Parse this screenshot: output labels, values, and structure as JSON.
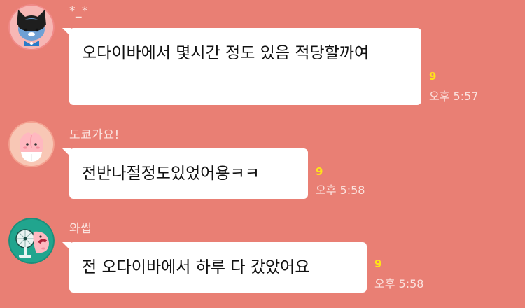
{
  "messages": [
    {
      "sender": "*_*",
      "avatar": "ryan-avatar",
      "text": "오다이바에서 몇시간 정도 있음 적당할까여",
      "unread": "9",
      "time": "오후 5:57"
    },
    {
      "sender": "도쿄가요!",
      "avatar": "apeach-avatar",
      "text": "전반나절정도있었어용ㅋㅋ",
      "unread": "9",
      "time": "오후 5:58"
    },
    {
      "sender": "와썹",
      "avatar": "apeach-fan-avatar",
      "text": "전 오다이바에서 하루 다 갔았어요",
      "unread": "9",
      "time": "오후 5:58"
    }
  ],
  "colors": {
    "background": "#E97F74",
    "bubble": "#FFFFFF",
    "unread": "#FFE417",
    "meta_text": "#FBE3DF"
  }
}
